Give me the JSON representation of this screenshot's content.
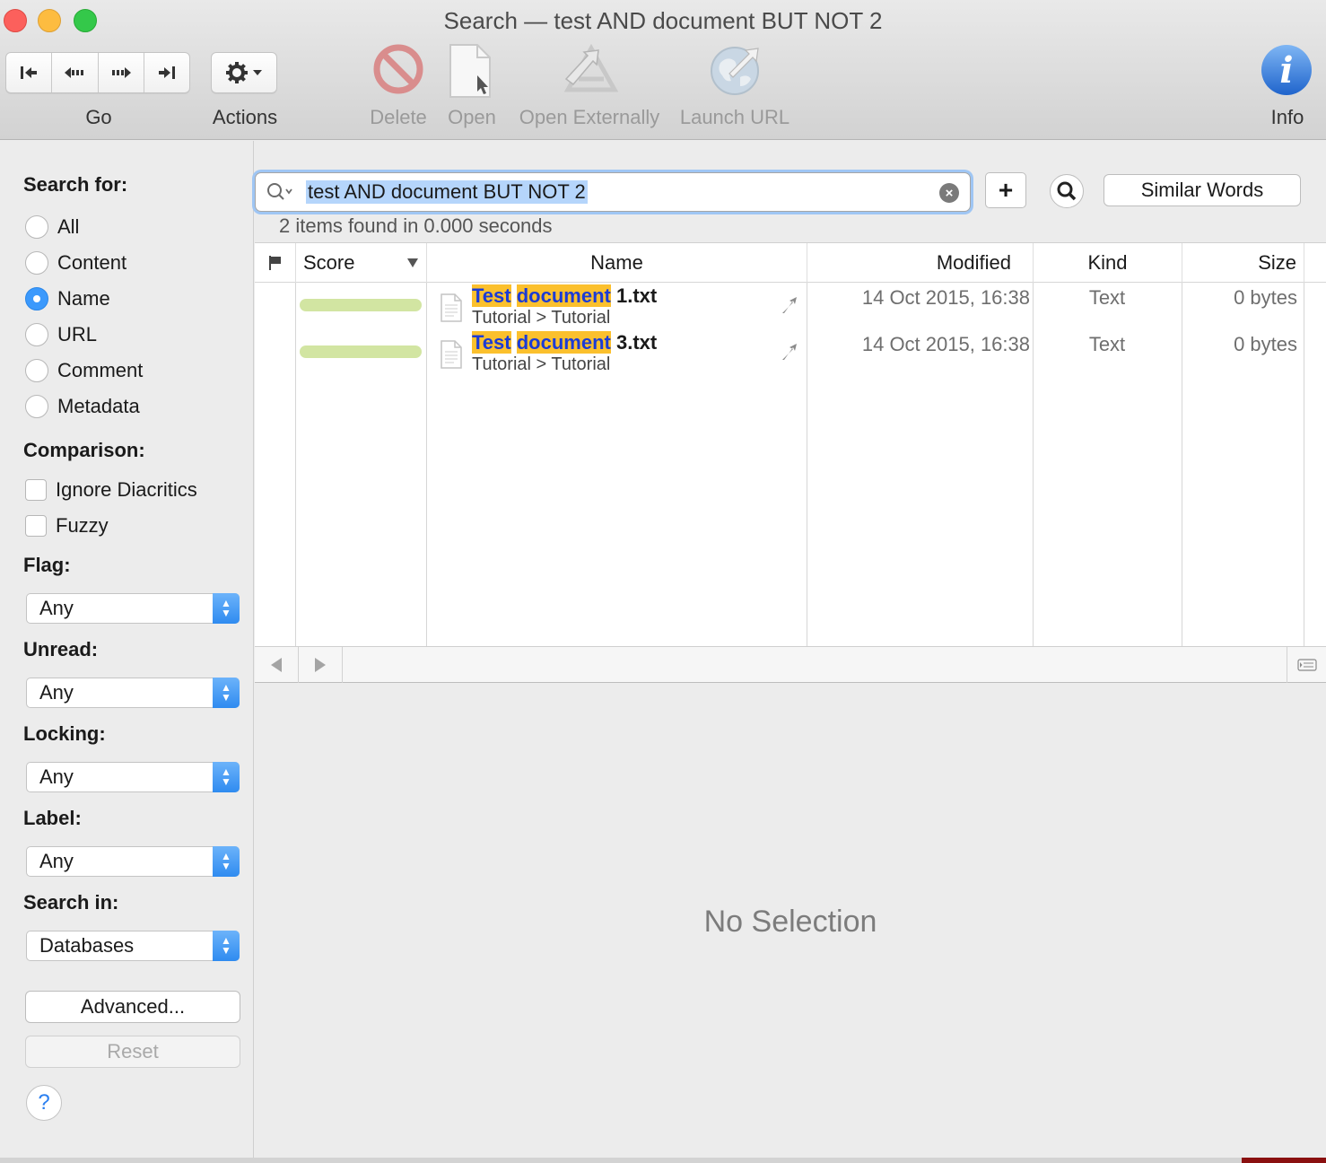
{
  "window": {
    "title": "Search — test AND document BUT NOT 2"
  },
  "toolbar": {
    "go_label": "Go",
    "actions_label": "Actions",
    "delete_label": "Delete",
    "open_label": "Open",
    "open_externally_label": "Open Externally",
    "launch_url_label": "Launch URL",
    "info_label": "Info"
  },
  "sidebar": {
    "search_for_heading": "Search for:",
    "search_for_options": [
      "All",
      "Content",
      "Name",
      "URL",
      "Comment",
      "Metadata"
    ],
    "search_for_selected": "Name",
    "comparison_heading": "Comparison:",
    "comparison_options": [
      "Ignore Diacritics",
      "Fuzzy"
    ],
    "flag_heading": "Flag:",
    "flag_value": "Any",
    "unread_heading": "Unread:",
    "unread_value": "Any",
    "locking_heading": "Locking:",
    "locking_value": "Any",
    "label_heading": "Label:",
    "label_value": "Any",
    "search_in_heading": "Search in:",
    "search_in_value": "Databases",
    "advanced_label": "Advanced...",
    "reset_label": "Reset",
    "help_label": "?"
  },
  "search": {
    "query": "test AND document BUT NOT 2",
    "add_label": "+",
    "similar_words_label": "Similar Words",
    "status": "2 items found in 0.000 seconds"
  },
  "table": {
    "columns": {
      "score": "Score",
      "name": "Name",
      "modified": "Modified",
      "kind": "Kind",
      "size": "Size"
    },
    "rows": [
      {
        "score": 1.0,
        "name_hl1": "Test",
        "name_hl2": "document",
        "name_rest": " 1.txt",
        "path": "Tutorial > Tutorial",
        "modified": "14 Oct 2015, 16:38",
        "kind": "Text",
        "size": "0 bytes"
      },
      {
        "score": 1.0,
        "name_hl1": "Test",
        "name_hl2": "document",
        "name_rest": " 3.txt",
        "path": "Tutorial > Tutorial",
        "modified": "14 Oct 2015, 16:38",
        "kind": "Text",
        "size": "0 bytes"
      }
    ]
  },
  "preview": {
    "empty_text": "No Selection"
  },
  "colors": {
    "accent": "#3b99fc",
    "highlight": "#fbc02d",
    "highlight_text": "#1b3bd6",
    "score_bar": "#d2e5a2"
  }
}
